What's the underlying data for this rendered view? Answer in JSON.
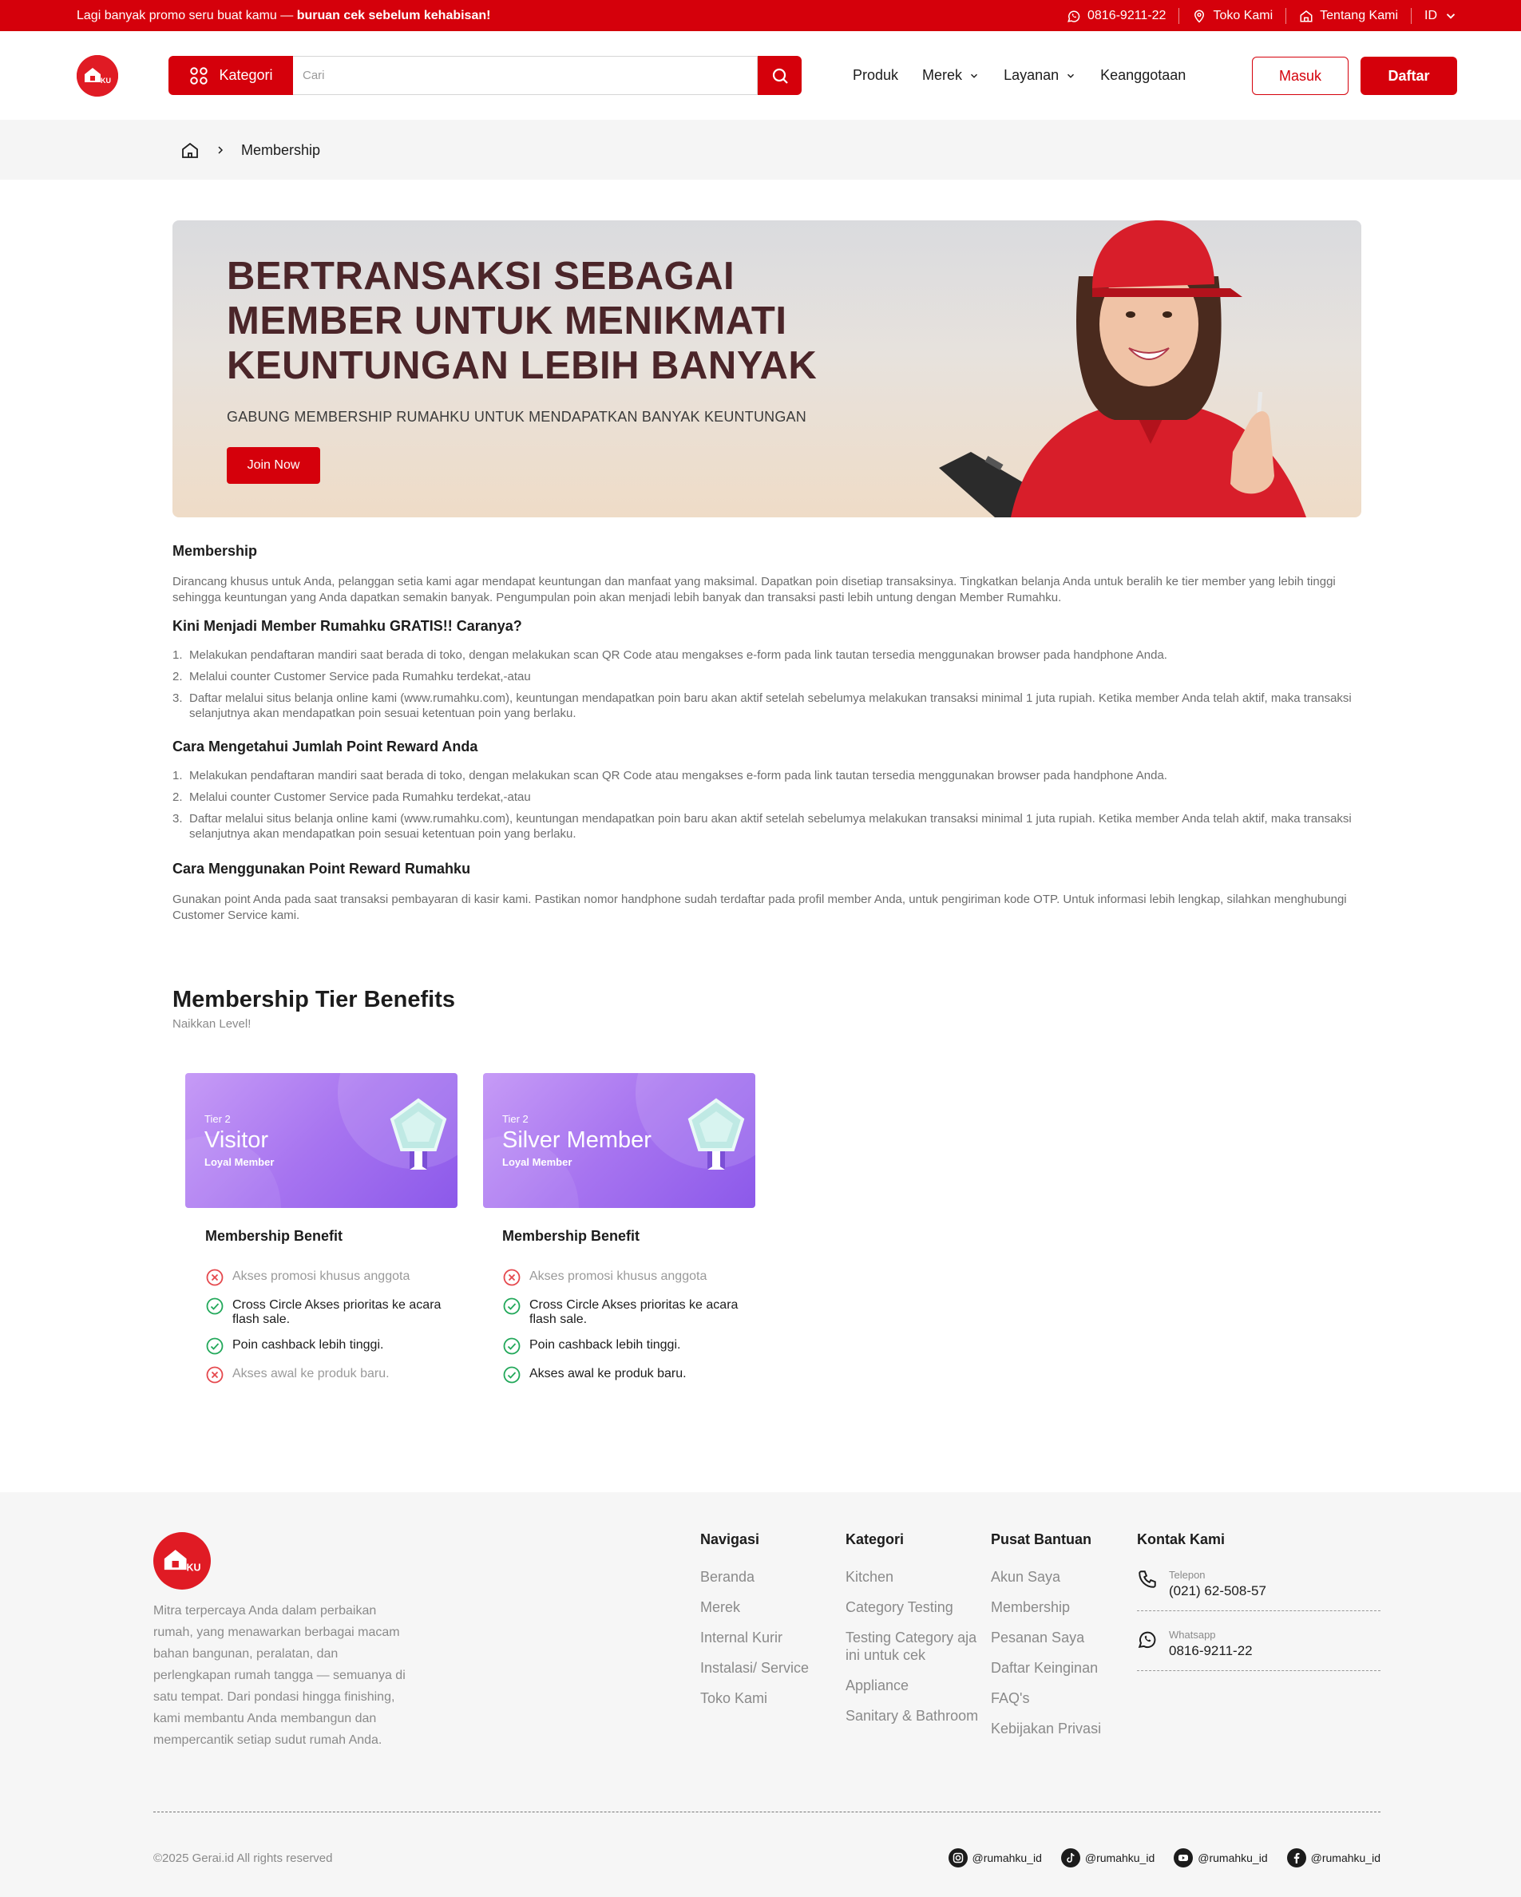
{
  "topbar": {
    "promo_text": "Lagi banyak promo seru buat kamu — ",
    "promo_bold": "buruan cek sebelum kehabisan!",
    "phone": "0816-9211-22",
    "store": "Toko Kami",
    "about": "Tentang Kami",
    "lang": "ID"
  },
  "header": {
    "kategori_label": "Kategori",
    "search_placeholder": "Cari",
    "nav": [
      "Produk",
      "Merek",
      "Layanan",
      "Keanggotaan"
    ],
    "login_label": "Masuk",
    "register_label": "Daftar"
  },
  "breadcrumb": {
    "current": "Membership"
  },
  "hero": {
    "title": "BERTRANSAKSI SEBAGAI MEMBER UNTUK MENIKMATI KEUNTUNGAN LEBIH BANYAK",
    "subtitle": "GABUNG MEMBERSHIP RUMAHKU UNTUK MENDAPATKAN BANYAK KEUNTUNGAN",
    "button": "Join Now"
  },
  "content": {
    "membership_title": "Membership",
    "membership_text": "Dirancang khusus untuk Anda, pelanggan setia kami agar mendapat keuntungan dan manfaat yang maksimal. Dapatkan poin disetiap transaksinya. Tingkatkan belanja Anda untuk beralih ke tier member yang lebih tinggi sehingga keuntungan yang Anda dapatkan semakin banyak. Pengumpulan poin akan menjadi lebih banyak dan transaksi pasti lebih untung dengan Member Rumahku.",
    "how_title": "Kini Menjadi Member Rumahku GRATIS!! Caranya?",
    "how_steps": [
      "Melakukan pendaftaran mandiri saat berada di toko, dengan melakukan scan QR Code atau mengakses e-form pada link tautan tersedia menggunakan browser pada handphone Anda.",
      "Melalui counter Customer Service pada Rumahku terdekat,-atau",
      "Daftar melalui situs belanja online kami (www.rumahku.com), keuntungan mendapatkan poin baru akan aktif setelah sebelumya melakukan transaksi minimal 1 juta rupiah. Ketika member Anda telah aktif, maka transaksi selanjutnya akan mendapatkan poin sesuai ketentuan poin yang berlaku."
    ],
    "points_title": "Cara Mengetahui Jumlah Point Reward Anda",
    "points_steps": [
      "Melakukan pendaftaran mandiri saat berada di toko, dengan melakukan scan QR Code atau mengakses e-form pada link tautan tersedia menggunakan browser pada handphone Anda.",
      "Melalui counter Customer Service pada Rumahku terdekat,-atau",
      "Daftar melalui situs belanja online kami (www.rumahku.com), keuntungan mendapatkan poin baru akan aktif setelah sebelumya melakukan transaksi minimal 1 juta rupiah. Ketika member Anda telah aktif, maka transaksi selanjutnya akan mendapatkan poin sesuai ketentuan poin yang berlaku."
    ],
    "use_title": "Cara Menggunakan Point Reward Rumahku",
    "use_text": "Gunakan point Anda pada saat transaksi pembayaran di kasir kami. Pastikan nomor handphone sudah terdaftar pada profil member Anda, untuk pengiriman kode OTP. Untuk informasi lebih lengkap, silahkan menghubungi Customer Service kami."
  },
  "tiers": {
    "title": "Membership Tier Benefits",
    "subtitle": "Naikkan Level!",
    "cards": [
      {
        "tier": "Tier 2",
        "name": "Visitor",
        "loyal": "Loyal Member",
        "benefit_title": "Membership Benefit",
        "benefits": [
          {
            "text": "Akses promosi khusus anggota",
            "ok": false
          },
          {
            "text": "Cross Circle Akses prioritas ke acara flash sale.",
            "ok": true
          },
          {
            "text": "Poin cashback lebih tinggi.",
            "ok": true
          },
          {
            "text": "Akses awal ke produk baru.",
            "ok": false
          }
        ]
      },
      {
        "tier": "Tier 2",
        "name": "Silver Member",
        "loyal": "Loyal Member",
        "benefit_title": "Membership Benefit",
        "benefits": [
          {
            "text": "Akses promosi khusus anggota",
            "ok": false
          },
          {
            "text": "Cross Circle Akses prioritas ke acara flash sale.",
            "ok": true
          },
          {
            "text": "Poin cashback lebih tinggi.",
            "ok": true
          },
          {
            "text": "Akses awal ke produk baru.",
            "ok": true
          }
        ]
      }
    ]
  },
  "footer": {
    "description": "Mitra terpercaya Anda dalam perbaikan rumah, yang menawarkan berbagai macam bahan bangunan, peralatan, dan perlengkapan rumah tangga — semuanya di satu tempat. Dari pondasi hingga finishing, kami membantu Anda membangun dan mempercantik setiap sudut rumah Anda.",
    "nav_title": "Navigasi",
    "nav_links": [
      "Beranda",
      "Merek",
      "Internal Kurir",
      "Instalasi/ Service",
      "Toko Kami"
    ],
    "cat_title": "Kategori",
    "cat_links": [
      "Kitchen",
      "Category Testing",
      "Testing Category aja ini untuk cek",
      "Appliance",
      "Sanitary & Bathroom"
    ],
    "help_title": "Pusat Bantuan",
    "help_links": [
      "Akun Saya",
      "Membership",
      "Pesanan Saya",
      "Daftar Keinginan",
      "FAQ's",
      "Kebijakan Privasi"
    ],
    "contact_title": "Kontak Kami",
    "phone_label": "Telepon",
    "phone_value": "(021) 62-508-57",
    "wa_label": "Whatsapp",
    "wa_value": "0816-9211-22",
    "copyright": "©2025 Gerai.id All rights reserved",
    "socials": [
      "@rumahku_id",
      "@rumahku_id",
      "@rumahku_id",
      "@rumahku_id"
    ]
  },
  "colors": {
    "brand_red": "#d5000b",
    "tier_purple": "#a774f0",
    "ok_green": "#22a85a",
    "no_red": "#e5484d"
  },
  "icons": [
    "whatsapp-icon",
    "location-icon",
    "home-icon",
    "chevron-down-icon",
    "grid-icon",
    "search-icon",
    "check-icon",
    "cross-icon",
    "phone-icon",
    "instagram-icon",
    "tiktok-icon",
    "youtube-icon",
    "facebook-icon",
    "medal-icon"
  ]
}
